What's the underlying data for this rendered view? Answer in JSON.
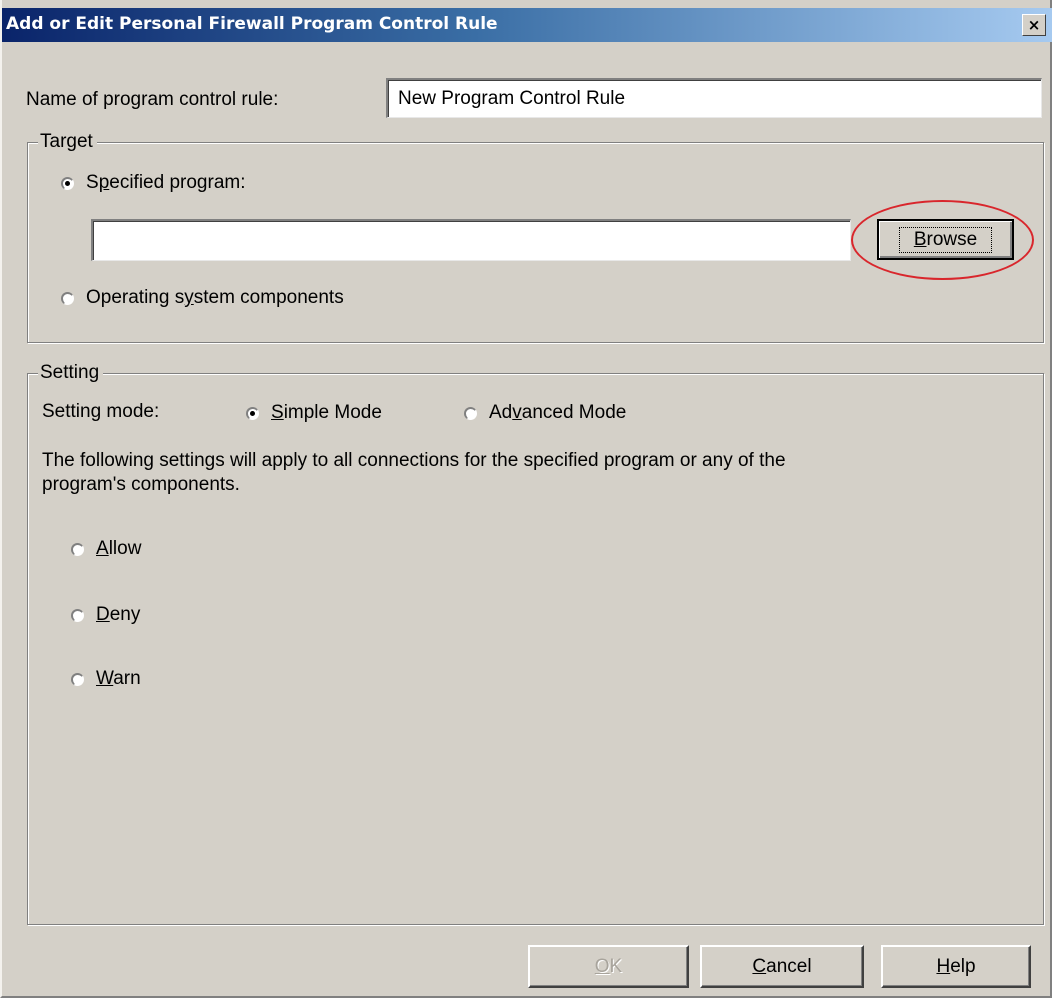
{
  "window": {
    "title": "Add or Edit Personal Firewall Program Control Rule",
    "close_glyph": "×"
  },
  "rule_name": {
    "label": "Name of program control rule:",
    "value": "New Program Control Rule"
  },
  "target": {
    "legend": "Target",
    "specified_program_label": "Specified program:",
    "specified_program_selected": true,
    "program_path_value": "",
    "browse_label": "Browse",
    "os_components_label": "Operating system components",
    "os_components_selected": false
  },
  "setting": {
    "legend": "Setting",
    "mode_label": "Setting mode:",
    "simple_mode_label": "Simple Mode",
    "simple_mode_selected": true,
    "advanced_mode_label": "Advanced Mode",
    "advanced_mode_selected": false,
    "description_line1": "The following settings will apply to all connections for the specified program or any of the",
    "description_line2": "program's components.",
    "actions": [
      {
        "label": "Allow",
        "selected": false
      },
      {
        "label": "Deny",
        "selected": false
      },
      {
        "label": "Warn",
        "selected": false
      }
    ]
  },
  "footer": {
    "ok_label": "OK",
    "ok_enabled": false,
    "cancel_label": "Cancel",
    "help_label": "Help"
  },
  "annotation": {
    "highlight_color": "#d9262c",
    "highlighted_element": "browse-button"
  },
  "colors": {
    "dialog_face": "#d4d0c8",
    "title_start": "#0a246a",
    "title_end": "#a6caf0"
  }
}
